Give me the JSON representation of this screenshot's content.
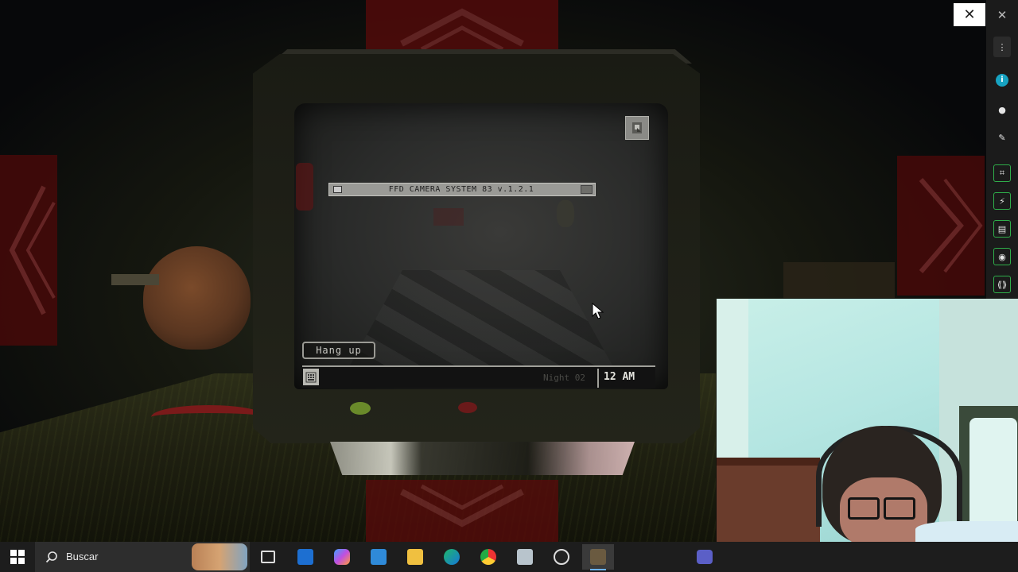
{
  "game": {
    "camera_title": "FFD CAMERA SYSTEM 83 v.1.2.1",
    "hang_up_label": "Hang up",
    "night_label": "Night 02",
    "time_label": "12 AM",
    "colors": {
      "ui_gray": "#9a9a96",
      "arrow_red": "#5a0a0a",
      "night_text": "#4a4a46"
    }
  },
  "overlay_rail": {
    "close_icon": "close-icon",
    "buttons": [
      "more-vertical-icon",
      "app-logo-icon",
      "info-icon",
      "pencil-icon",
      "screenshot-icon",
      "flash-icon",
      "note-icon",
      "chat-icon",
      "broadcast-icon"
    ],
    "accent": "#2fae4a"
  },
  "taskbar": {
    "search_placeholder": "Buscar",
    "apps": [
      "task-view-icon",
      "outlook-icon",
      "copilot-icon",
      "store-icon",
      "file-explorer-icon",
      "edge-icon",
      "chrome-icon",
      "app-window-icon",
      "obs-icon",
      "game-icon",
      "teams-icon"
    ]
  }
}
